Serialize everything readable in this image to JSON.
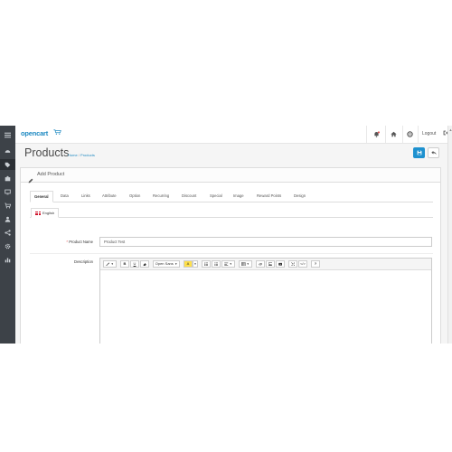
{
  "app": {
    "logo_text": "opencart",
    "logout_label": "Logout"
  },
  "sidebar": {
    "items": [
      {
        "icon": "menu-icon"
      },
      {
        "icon": "dashboard-icon"
      },
      {
        "icon": "tag-icon",
        "active": true
      },
      {
        "icon": "puzzle-icon"
      },
      {
        "icon": "desktop-icon"
      },
      {
        "icon": "cart-icon"
      },
      {
        "icon": "user-icon"
      },
      {
        "icon": "share-icon"
      },
      {
        "icon": "cog-icon"
      },
      {
        "icon": "bar-chart-icon"
      }
    ]
  },
  "header": {
    "title": "Products",
    "breadcrumb": {
      "home": "Home",
      "separator": "/",
      "current": "Products"
    }
  },
  "panel": {
    "title": "Add Product"
  },
  "tabs": [
    {
      "label": "General",
      "active": true
    },
    {
      "label": "Data"
    },
    {
      "label": "Links"
    },
    {
      "label": "Attribute"
    },
    {
      "label": "Option"
    },
    {
      "label": "Recurring"
    },
    {
      "label": "Discount"
    },
    {
      "label": "Special"
    },
    {
      "label": "Image"
    },
    {
      "label": "Reward Points"
    },
    {
      "label": "Design"
    }
  ],
  "language_tab": {
    "label": "English"
  },
  "form": {
    "product_name_label": "Product Name",
    "product_name_required": "*",
    "product_name_value": "Product Test",
    "description_label": "Description"
  },
  "editor_toolbar": {
    "font_label": "Open Sans",
    "bold_label": "B",
    "underline_label": "U",
    "highlight_label": "A",
    "help_label": "?",
    "code_label": "</>"
  },
  "colors": {
    "sidebar_bg": "#3d4248",
    "brand_blue": "#1f8ac2",
    "primary_button": "#1e91cf",
    "required_red": "#e24b4b",
    "highlight_yellow": "#ffe04a"
  }
}
